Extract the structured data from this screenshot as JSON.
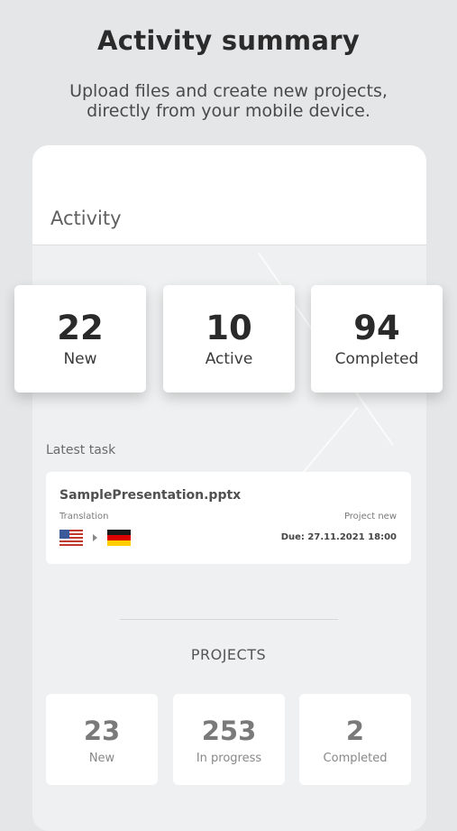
{
  "header": {
    "title": "Activity summary",
    "subtitle_line1": "Upload files and create new projects,",
    "subtitle_line2": "directly from your mobile device."
  },
  "app": {
    "screen_title": "Activity",
    "stats": [
      {
        "value": "22",
        "label": "New"
      },
      {
        "value": "10",
        "label": "Active"
      },
      {
        "value": "94",
        "label": "Completed"
      }
    ],
    "latest_task_label": "Latest task",
    "latest_task": {
      "file_name": "SamplePresentation.pptx",
      "type": "Translation",
      "status": "Project new",
      "due": "Due: 27.11.2021 18:00",
      "source_flag": "us-flag-icon",
      "target_flag": "germany-flag-icon"
    },
    "projects_heading": "PROJECTS",
    "projects": [
      {
        "value": "23",
        "label": "New"
      },
      {
        "value": "253",
        "label": "In progress"
      },
      {
        "value": "2",
        "label": "Completed"
      }
    ]
  },
  "colors": {
    "background": "#e4e6e8",
    "card": "#ffffff",
    "text_dark": "#2b2b2b",
    "flag_de_black": "#1a1a1a",
    "flag_de_red": "#dd0000",
    "flag_de_gold": "#ffce00"
  }
}
